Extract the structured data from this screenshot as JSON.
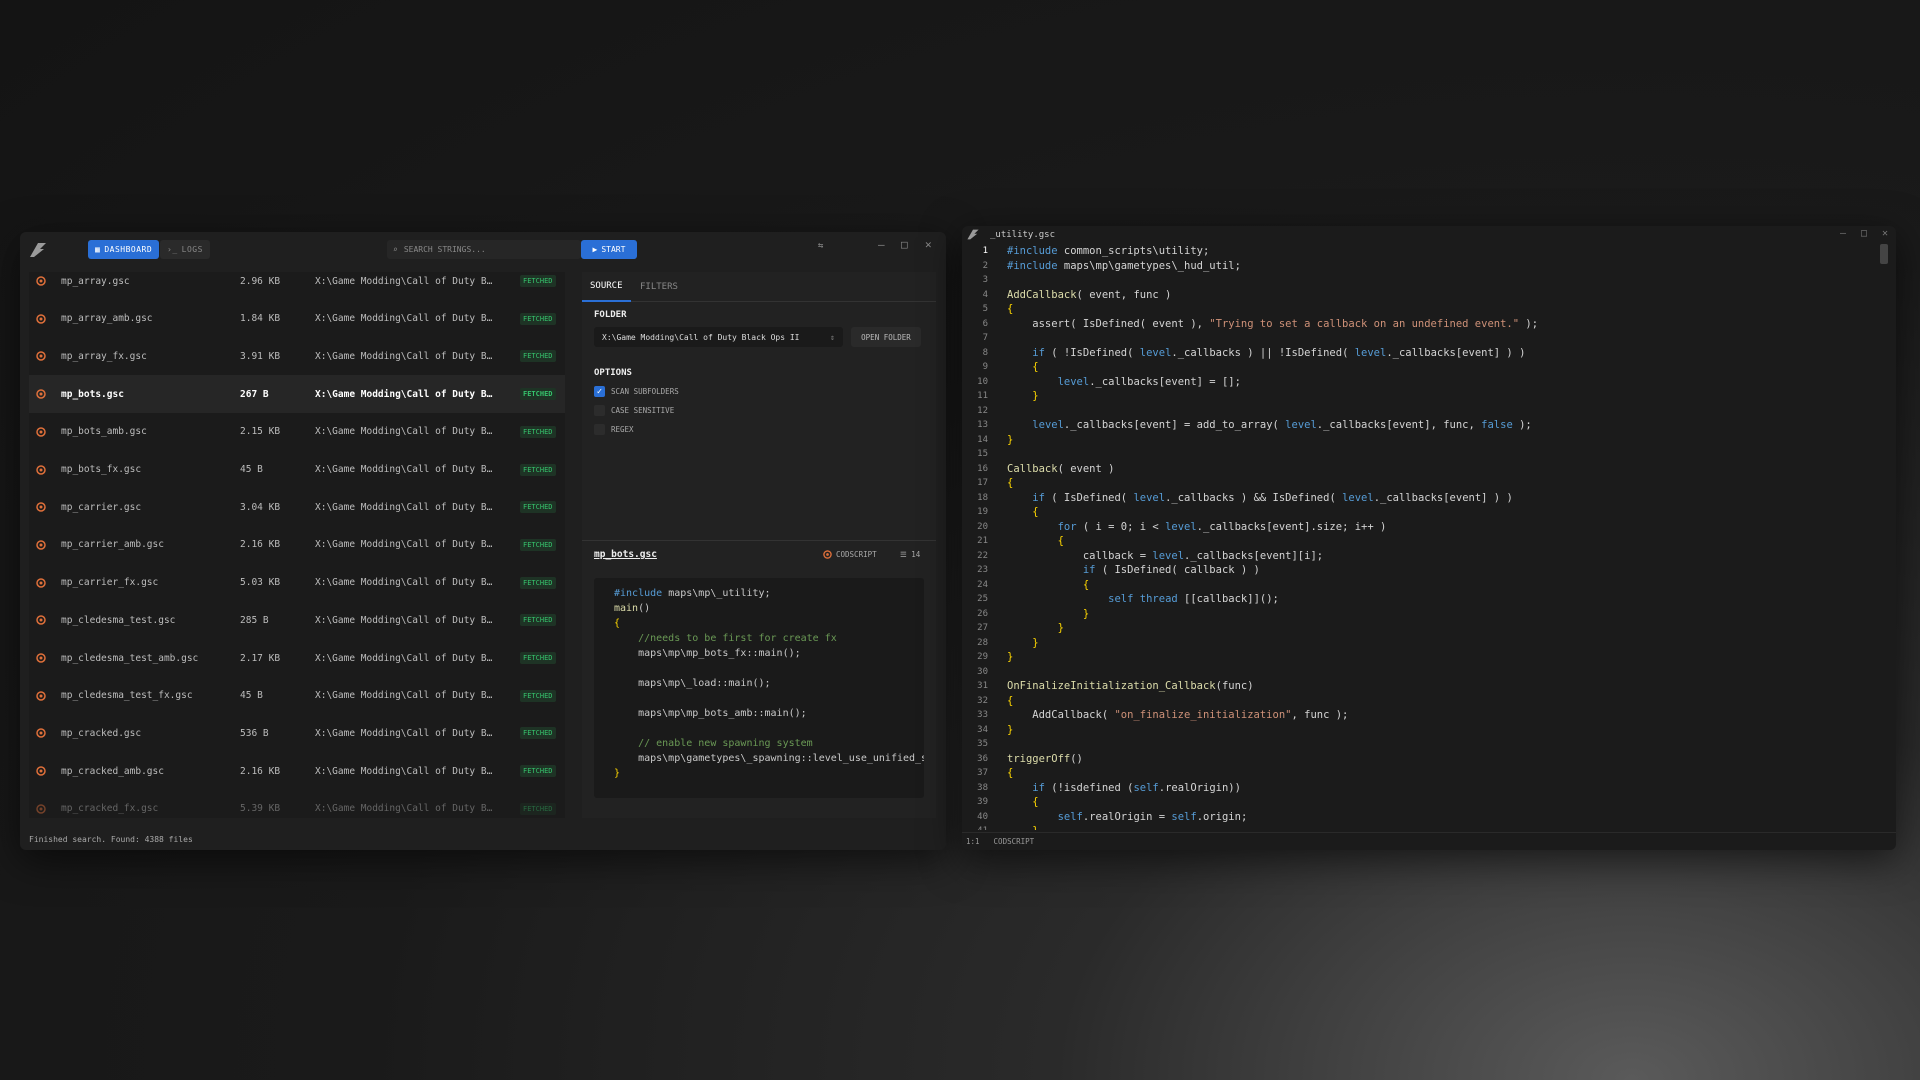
{
  "nav": {
    "dashboard": "DASHBOARD",
    "logs": "LOGS"
  },
  "search": {
    "placeholder": "SEARCH STRINGS...",
    "start": "START"
  },
  "files": [
    {
      "name": "mp_array.gsc",
      "size": "2.96 KB",
      "path": "X:\\Game Modding\\Call of Duty B…",
      "status": "FETCHED"
    },
    {
      "name": "mp_array_amb.gsc",
      "size": "1.84 KB",
      "path": "X:\\Game Modding\\Call of Duty B…",
      "status": "FETCHED"
    },
    {
      "name": "mp_array_fx.gsc",
      "size": "3.91 KB",
      "path": "X:\\Game Modding\\Call of Duty B…",
      "status": "FETCHED"
    },
    {
      "name": "mp_bots.gsc",
      "size": "267 B",
      "path": "X:\\Game Modding\\Call of Duty B…",
      "status": "FETCHED"
    },
    {
      "name": "mp_bots_amb.gsc",
      "size": "2.15 KB",
      "path": "X:\\Game Modding\\Call of Duty B…",
      "status": "FETCHED"
    },
    {
      "name": "mp_bots_fx.gsc",
      "size": "45 B",
      "path": "X:\\Game Modding\\Call of Duty B…",
      "status": "FETCHED"
    },
    {
      "name": "mp_carrier.gsc",
      "size": "3.04 KB",
      "path": "X:\\Game Modding\\Call of Duty B…",
      "status": "FETCHED"
    },
    {
      "name": "mp_carrier_amb.gsc",
      "size": "2.16 KB",
      "path": "X:\\Game Modding\\Call of Duty B…",
      "status": "FETCHED"
    },
    {
      "name": "mp_carrier_fx.gsc",
      "size": "5.03 KB",
      "path": "X:\\Game Modding\\Call of Duty B…",
      "status": "FETCHED"
    },
    {
      "name": "mp_cledesma_test.gsc",
      "size": "285 B",
      "path": "X:\\Game Modding\\Call of Duty B…",
      "status": "FETCHED"
    },
    {
      "name": "mp_cledesma_test_amb.gsc",
      "size": "2.17 KB",
      "path": "X:\\Game Modding\\Call of Duty B…",
      "status": "FETCHED"
    },
    {
      "name": "mp_cledesma_test_fx.gsc",
      "size": "45 B",
      "path": "X:\\Game Modding\\Call of Duty B…",
      "status": "FETCHED"
    },
    {
      "name": "mp_cracked.gsc",
      "size": "536 B",
      "path": "X:\\Game Modding\\Call of Duty B…",
      "status": "FETCHED"
    },
    {
      "name": "mp_cracked_amb.gsc",
      "size": "2.16 KB",
      "path": "X:\\Game Modding\\Call of Duty B…",
      "status": "FETCHED"
    },
    {
      "name": "mp_cracked_fx.gsc",
      "size": "5.39 KB",
      "path": "X:\\Game Modding\\Call of Duty B…",
      "status": "FETCHED"
    }
  ],
  "status_text": "Finished search. Found: 4388 files",
  "panel": {
    "tab_source": "SOURCE",
    "tab_filters": "FILTERS",
    "folder_label": "FOLDER",
    "folder_value": "X:\\Game Modding\\Call of Duty Black Ops II",
    "open_folder": "OPEN FOLDER",
    "options_label": "OPTIONS",
    "opt_scan": "SCAN SUBFOLDERS",
    "opt_case": "CASE SENSITIVE",
    "opt_regex": "REGEX",
    "preview_file": "mp_bots.gsc",
    "preview_lang": "CODSCRIPT",
    "preview_lines": "14"
  },
  "preview_code": [
    "#include maps\\mp\\_utility;",
    "main()",
    "{",
    "    //needs to be first for create fx",
    "    maps\\mp\\mp_bots_fx::main();",
    "",
    "    maps\\mp\\_load::main();",
    "",
    "    maps\\mp\\mp_bots_amb::main();",
    "",
    "    // enable new spawning system",
    "    maps\\mp\\gametypes\\_spawning::level_use_unified_spawning( true );",
    "}"
  ],
  "editor": {
    "title": "_utility.gsc",
    "status_pos": "1:1",
    "status_lang": "CODSCRIPT",
    "lines": [
      "#include common_scripts\\utility;",
      "#include maps\\mp\\gametypes\\_hud_util;",
      "",
      "AddCallback( event, func )",
      "{",
      "    assert( IsDefined( event ), \"Trying to set a callback on an undefined event.\" );",
      "",
      "    if ( !IsDefined( level._callbacks ) || !IsDefined( level._callbacks[event] ) )",
      "    {",
      "        level._callbacks[event] = [];",
      "    }",
      "",
      "    level._callbacks[event] = add_to_array( level._callbacks[event], func, false );",
      "}",
      "",
      "Callback( event )",
      "{",
      "    if ( IsDefined( level._callbacks ) && IsDefined( level._callbacks[event] ) )",
      "    {",
      "        for ( i = 0; i < level._callbacks[event].size; i++ )",
      "        {",
      "            callback = level._callbacks[event][i];",
      "            if ( IsDefined( callback ) )",
      "            {",
      "                self thread [[callback]]();",
      "            }",
      "        }",
      "    }",
      "}",
      "",
      "OnFinalizeInitialization_Callback(func)",
      "{",
      "    AddCallback( \"on_finalize_initialization\", func );",
      "}",
      "",
      "triggerOff()",
      "{",
      "    if (!isdefined (self.realOrigin))",
      "    {",
      "        self.realOrigin = self.origin;",
      "    }"
    ]
  },
  "colors": {
    "accent": "#2a6fd6",
    "fetched": "#36c36c",
    "file_icon": "#e0703a"
  }
}
